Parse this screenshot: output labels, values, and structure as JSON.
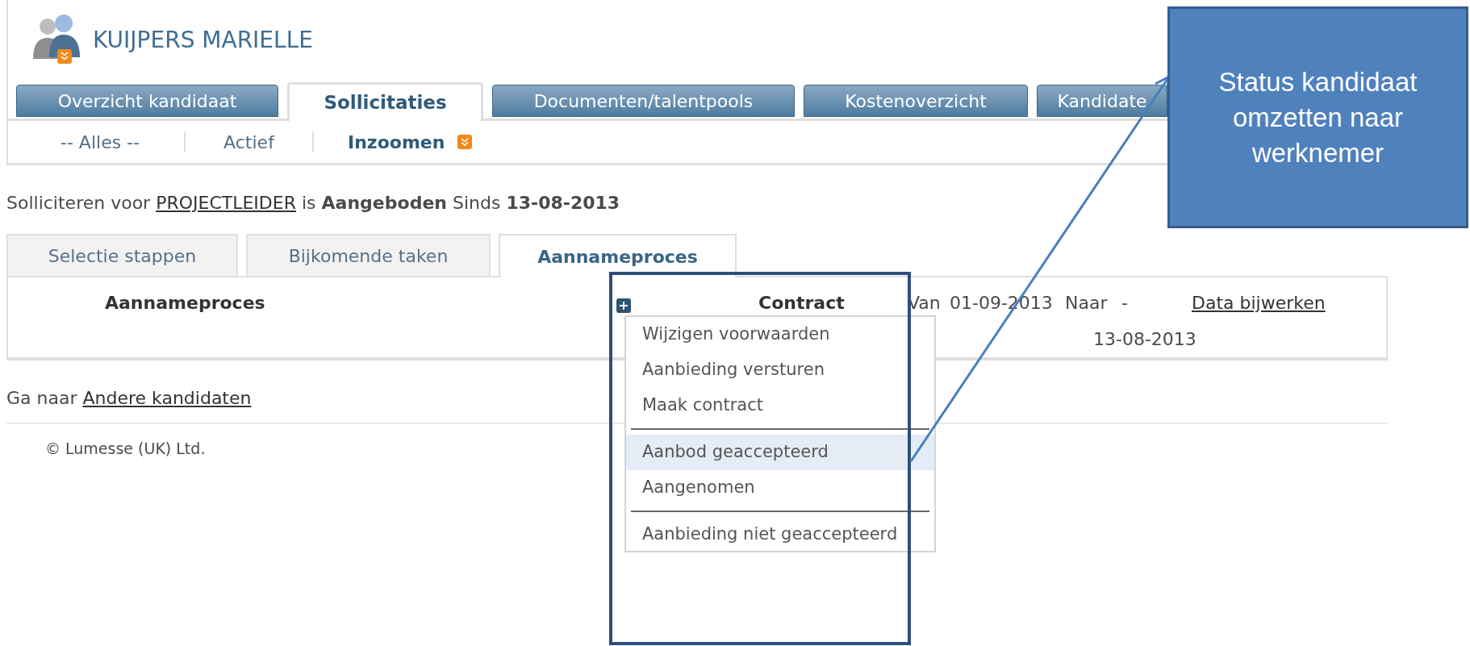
{
  "header": {
    "title": "KUIJPERS MARIELLE"
  },
  "tabs": [
    {
      "label": "Overzicht kandidaat",
      "selected": false
    },
    {
      "label": "Sollicitaties",
      "selected": true
    },
    {
      "label": "Documenten/talentpools",
      "selected": false
    },
    {
      "label": "Kostenoverzicht",
      "selected": false
    },
    {
      "label": "Kandidate",
      "selected": false
    }
  ],
  "subnav": [
    {
      "label": "-- Alles --",
      "selected": false
    },
    {
      "label": "Actief",
      "selected": false
    },
    {
      "label": "Inzoomen",
      "selected": true
    }
  ],
  "status_line": {
    "prefix": "Solliciteren voor",
    "job_link": "PROJECTLEIDER",
    "suffix": "is **Aangeboden** Sinds **13-08-2013**"
  },
  "inner_tabs": [
    {
      "label": "Selectie stappen",
      "selected": false
    },
    {
      "label": "Bijkomende taken",
      "selected": false
    },
    {
      "label": "Aannameproces",
      "selected": true
    }
  ],
  "panel": {
    "heading": "Aannameproces",
    "step": {
      "name": "Contract",
      "from_label": "Van",
      "from": "01-09-2013",
      "to_label": "Naar",
      "to": "-",
      "to_date": "13-08-2013",
      "action": "Data bijwerken"
    }
  },
  "goto": {
    "prefix": "Ga naar",
    "link": "Andere kandidaten"
  },
  "footer": "© Lumesse (UK) Ltd.",
  "menu": {
    "groups": [
      {
        "items": [
          {
            "label": "Wijzigen voorwaarden",
            "selected": false
          },
          {
            "label": "Aanbieding versturen",
            "selected": false
          },
          {
            "label": "Maak contract",
            "selected": false
          }
        ]
      },
      {
        "items": [
          {
            "label": "Aanbod geaccepteerd",
            "selected": true
          },
          {
            "label": "Aangenomen",
            "selected": false
          }
        ]
      },
      {
        "items": [
          {
            "label": "Aanbieding niet geaccepteerd",
            "selected": false
          }
        ]
      }
    ]
  },
  "callout": {
    "text": "Status kandidaat omzetten naar werknemer"
  }
}
